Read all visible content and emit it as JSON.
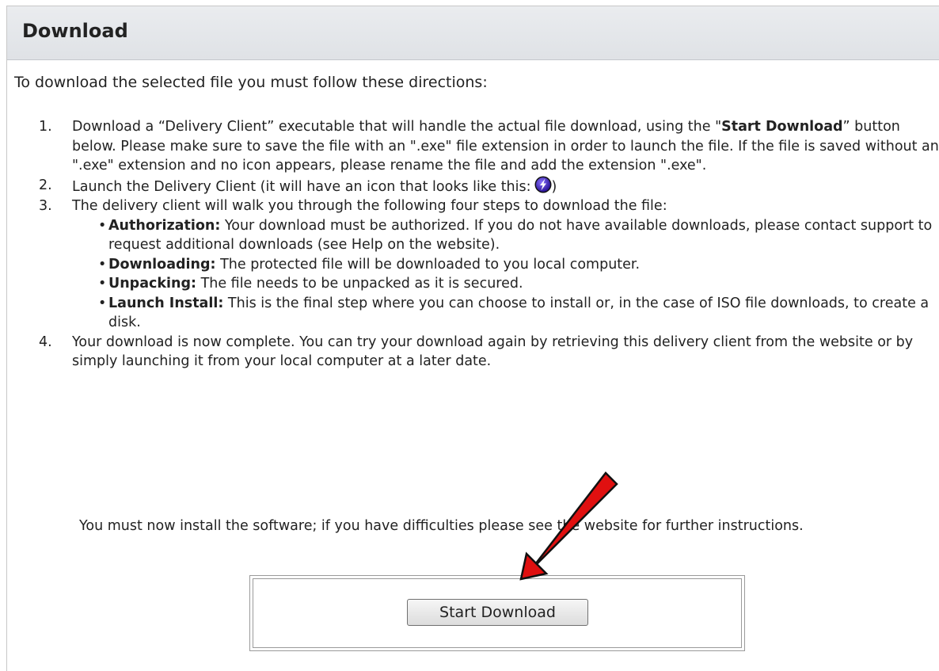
{
  "panel": {
    "title": "Download"
  },
  "intro": "To download the selected file you must follow these directions:",
  "steps": [
    {
      "number": "1.",
      "text_pre": "Download a “Delivery Client” executable that will handle the actual file download, using the \"",
      "bold": "Start Download",
      "text_post": "” button below. Please make sure to save the file with an \".exe\" file extension in order to launch the file. If the file is saved without an \".exe\" extension and no icon appears, please rename the file and add the extension \".exe\"."
    },
    {
      "number": "2.",
      "text_pre": "Launch the Delivery Client (it will have an icon that looks like this:",
      "text_post": ")"
    },
    {
      "number": "3.",
      "text": "The delivery client will walk you through the following four steps to download the file:",
      "substeps": [
        {
          "bullet": "•",
          "label": "Authorization:",
          "text": " Your download must be authorized. If you do not have available downloads, please contact support to request additional downloads (see Help on the website)."
        },
        {
          "bullet": "•",
          "label": "Downloading:",
          "text": " The protected file will be downloaded to you local computer."
        },
        {
          "bullet": "•",
          "label": "Unpacking:",
          "text": " The file needs to be unpacked as it is secured."
        },
        {
          "bullet": "•",
          "label": "Launch Install:",
          "text": " This is the final step where you can choose to install or, in the case of ISO file downloads, to create a disk."
        }
      ]
    },
    {
      "number": "4.",
      "text": "Your download is now complete. You can try your download again by retrieving this delivery client from the website or by simply launching it from your local computer at a later date."
    }
  ],
  "install_note": "You must now install the software; if you have difficulties please see the website for further instructions.",
  "start_button": {
    "label": "Start Download"
  },
  "icons": {
    "delivery_client": "lightning-bolt-icon",
    "annotation": "red-arrow"
  },
  "colors": {
    "header_bg": "#e3e6ea",
    "arrow_fill": "#e01010",
    "icon_purple": "#4a2fc8"
  }
}
